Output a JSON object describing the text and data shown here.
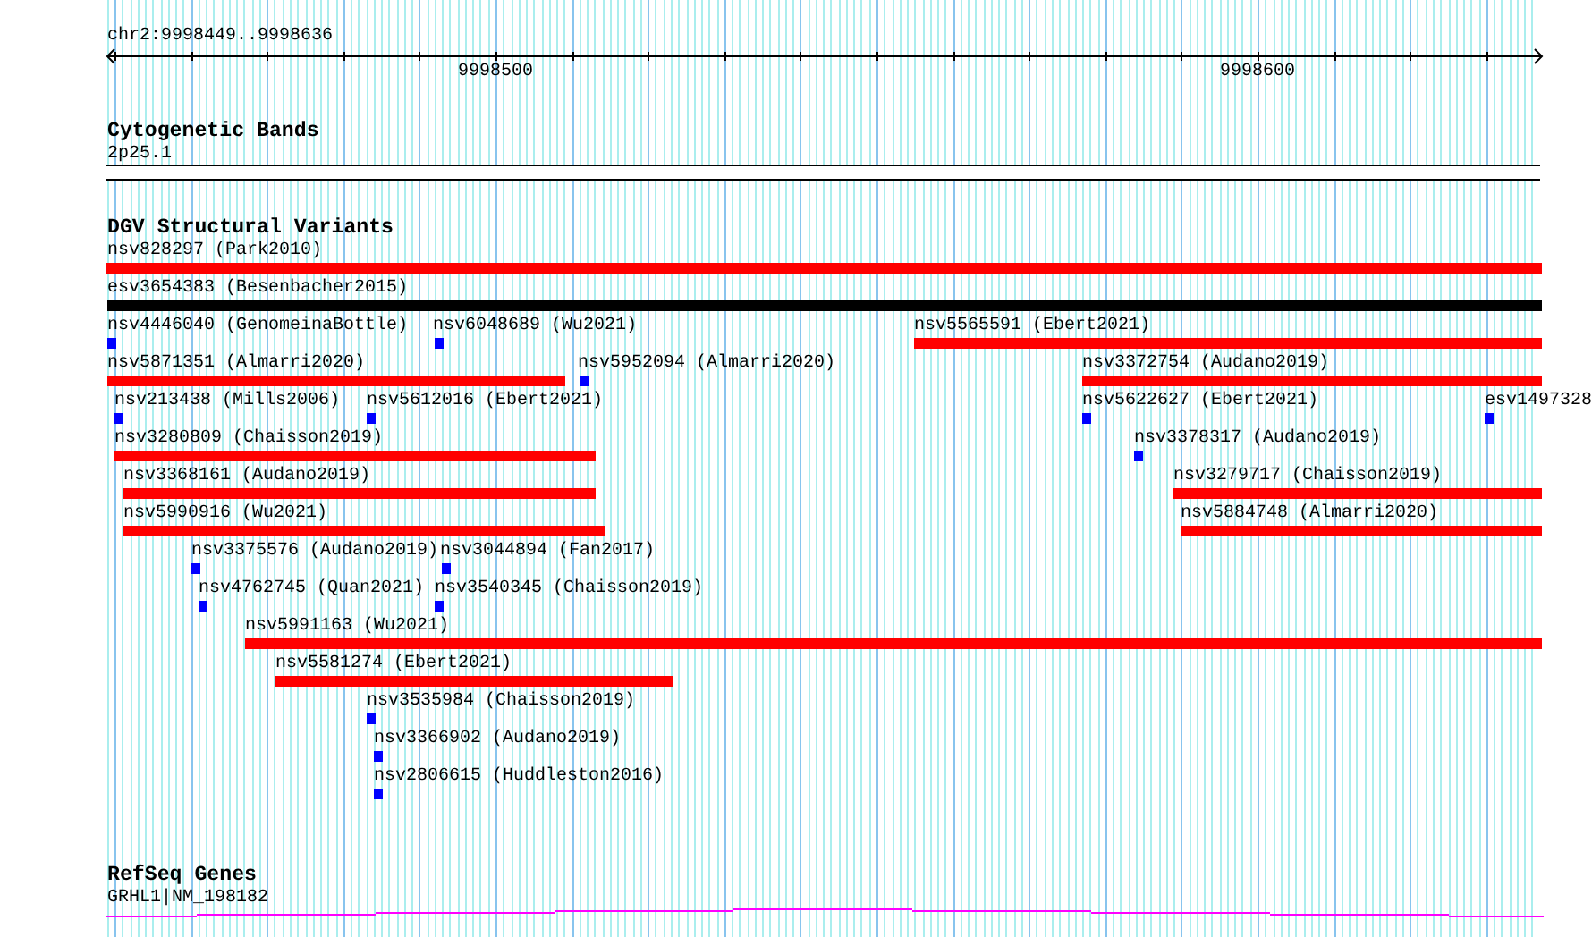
{
  "ruler": {
    "location": "chr2:9998449..9998636",
    "ticks": [
      "9998500",
      "9998600"
    ]
  },
  "tracks": [
    {
      "kind": "bands",
      "title": "Cytogenetic Bands",
      "items": [
        {
          "label": "2p25.1"
        }
      ]
    },
    {
      "kind": "variants",
      "title": "DGV Structural Variants",
      "rows": [
        [
          {
            "label": "nsv828297 (Park2010)",
            "kind": "bar",
            "color": "#ff0000"
          }
        ],
        [
          {
            "label": "esv3654383 (Besenbacher2015)",
            "kind": "bar",
            "color": "#000000"
          }
        ],
        [
          {
            "label": "nsv4446040 (GenomeinaBottle)",
            "kind": "point",
            "color": "#0000ff"
          },
          {
            "label": "nsv6048689 (Wu2021)",
            "kind": "point",
            "color": "#0000ff"
          },
          {
            "label": "nsv5565591 (Ebert2021)",
            "kind": "bar",
            "color": "#ff0000"
          }
        ],
        [
          {
            "label": "nsv5871351 (Almarri2020)",
            "kind": "bar",
            "color": "#ff0000"
          },
          {
            "label": "nsv5952094 (Almarri2020)",
            "kind": "point",
            "color": "#0000ff"
          },
          {
            "label": "nsv3372754 (Audano2019)",
            "kind": "bar",
            "color": "#ff0000"
          }
        ],
        [
          {
            "label": "nsv213438 (Mills2006)",
            "kind": "point",
            "color": "#0000ff"
          },
          {
            "label": "nsv5612016 (Ebert2021)",
            "kind": "point",
            "color": "#0000ff"
          },
          {
            "label": "nsv5622627 (Ebert2021)",
            "kind": "point",
            "color": "#0000ff"
          },
          {
            "label": "esv1497328",
            "kind": "point",
            "color": "#0000ff"
          }
        ],
        [
          {
            "label": "nsv3280809 (Chaisson2019)",
            "kind": "bar",
            "color": "#ff0000"
          },
          {
            "label": "nsv3378317 (Audano2019)",
            "kind": "point",
            "color": "#0000ff"
          }
        ],
        [
          {
            "label": "nsv3368161 (Audano2019)",
            "kind": "bar",
            "color": "#ff0000"
          },
          {
            "label": "nsv3279717 (Chaisson2019)",
            "kind": "bar",
            "color": "#ff0000"
          }
        ],
        [
          {
            "label": "nsv5990916 (Wu2021)",
            "kind": "bar",
            "color": "#ff0000"
          },
          {
            "label": "nsv5884748 (Almarri2020)",
            "kind": "bar",
            "color": "#ff0000"
          }
        ],
        [
          {
            "label": "nsv3375576 (Audano2019)",
            "kind": "point",
            "color": "#0000ff"
          },
          {
            "label": "nsv3044894 (Fan2017)",
            "kind": "point",
            "color": "#0000ff"
          }
        ],
        [
          {
            "label": "nsv4762745 (Quan2021)",
            "kind": "point",
            "color": "#0000ff"
          },
          {
            "label": "nsv3540345 (Chaisson2019)",
            "kind": "point",
            "color": "#0000ff"
          }
        ],
        [
          {
            "label": "nsv5991163 (Wu2021)",
            "kind": "bar",
            "color": "#ff0000"
          }
        ],
        [
          {
            "label": "nsv5581274 (Ebert2021)",
            "kind": "bar",
            "color": "#ff0000"
          }
        ],
        [
          {
            "label": "nsv3535984 (Chaisson2019)",
            "kind": "point",
            "color": "#0000ff"
          }
        ],
        [
          {
            "label": "nsv3366902 (Audano2019)",
            "kind": "point",
            "color": "#0000ff"
          }
        ],
        [
          {
            "label": "nsv2806615 (Huddleston2016)",
            "kind": "point",
            "color": "#0000ff"
          }
        ]
      ]
    },
    {
      "kind": "genes",
      "title": "RefSeq Genes",
      "items": [
        {
          "label": "GRHL1|NM_198182"
        }
      ]
    }
  ]
}
